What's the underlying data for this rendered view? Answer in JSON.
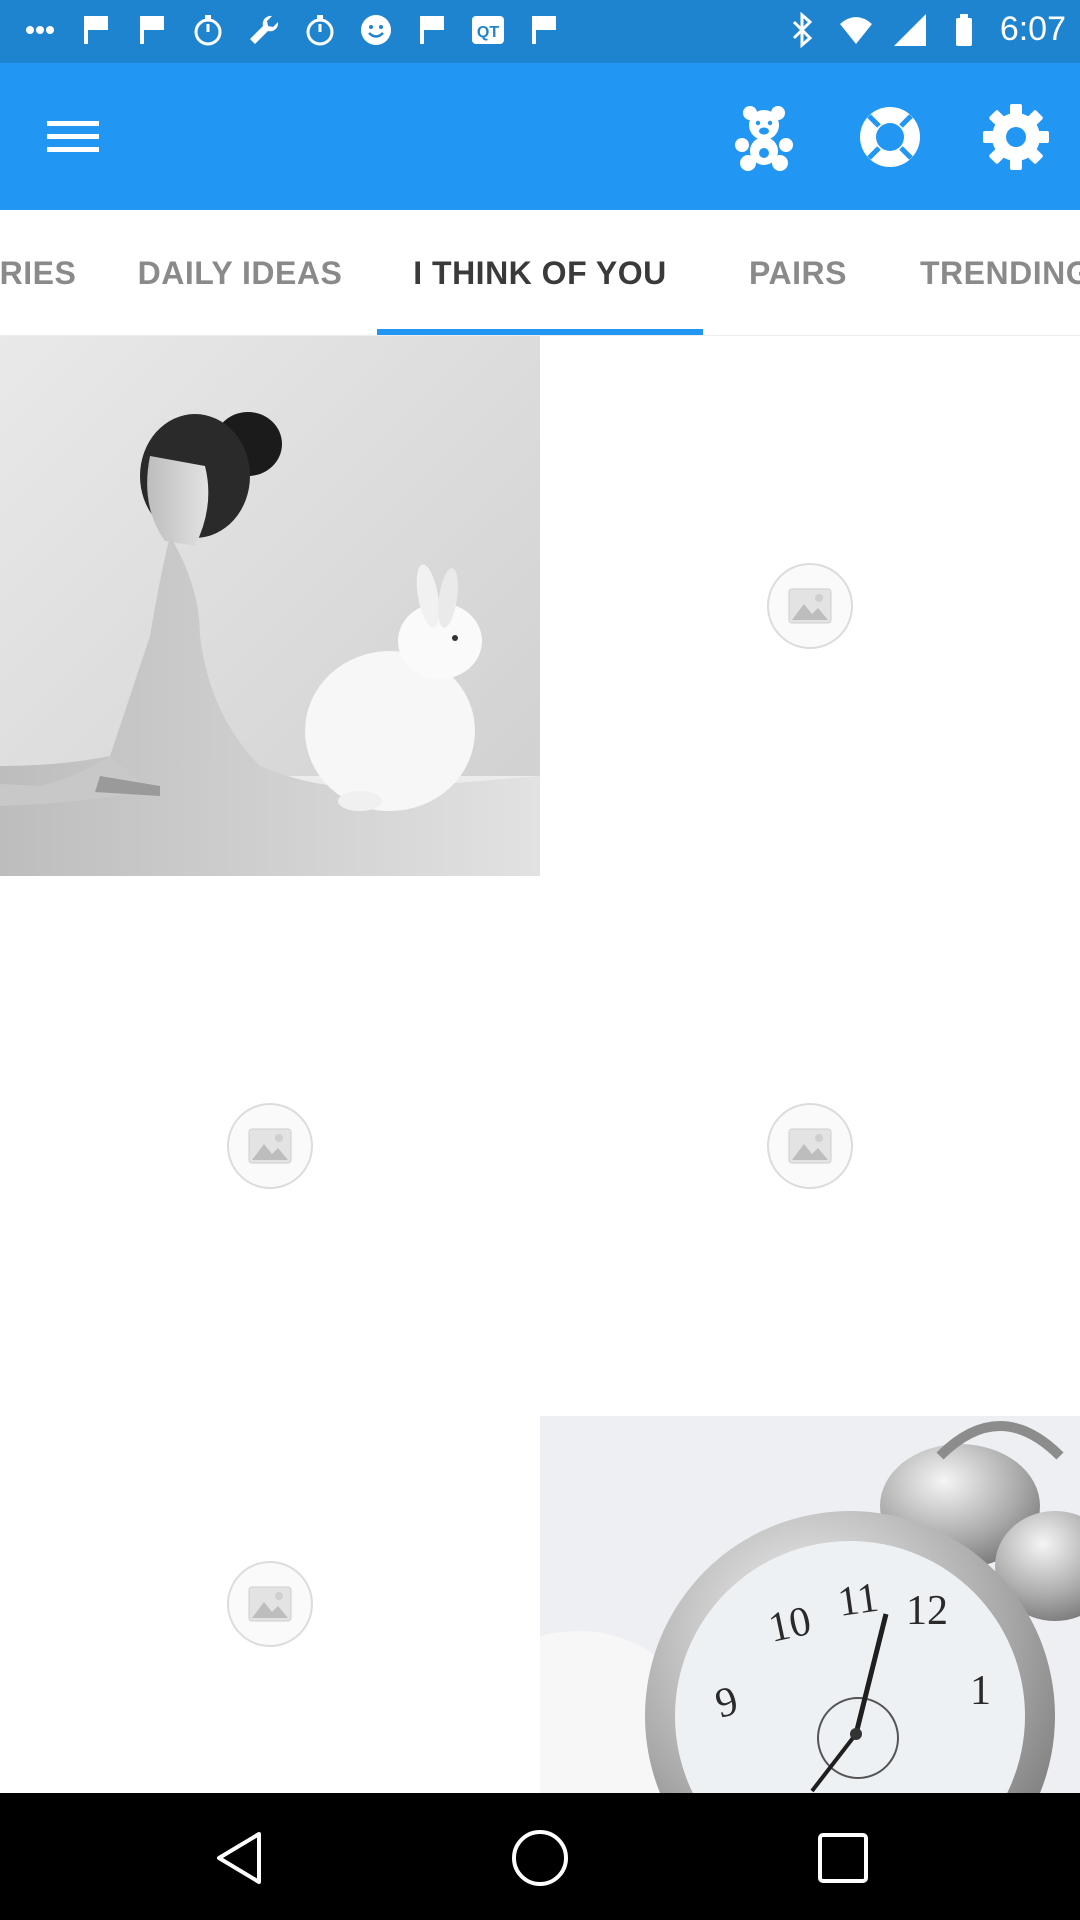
{
  "status_bar": {
    "time": "6:07",
    "left_icons": [
      "more-dots-icon",
      "flag-icon",
      "flag-icon",
      "timer-icon",
      "wrench-icon",
      "timer-icon",
      "smiley-icon",
      "flag-icon",
      "qt-icon",
      "flag-icon"
    ],
    "right_icons": [
      "bluetooth-icon",
      "wifi-icon",
      "signal-icon",
      "battery-icon"
    ],
    "background": "#1f84cf"
  },
  "app_bar": {
    "background": "#2196f3",
    "menu_icon": "menu-icon",
    "actions": [
      "teddy-bear-icon",
      "lifebuoy-icon",
      "settings-icon"
    ]
  },
  "tabs": {
    "items": [
      {
        "label": "RIES",
        "active": false
      },
      {
        "label": "DAILY IDEAS",
        "active": false
      },
      {
        "label": "I THINK OF YOU",
        "active": true
      },
      {
        "label": "PAIRS",
        "active": false
      },
      {
        "label": "TRENDING",
        "active": false
      }
    ],
    "indicator_color": "#2196f3"
  },
  "grid": {
    "items": [
      {
        "kind": "photo",
        "subject": "woman-with-rabbit"
      },
      {
        "kind": "placeholder",
        "icon": "image-placeholder-icon"
      },
      {
        "kind": "placeholder",
        "icon": "image-placeholder-icon"
      },
      {
        "kind": "placeholder",
        "icon": "image-placeholder-icon"
      },
      {
        "kind": "placeholder",
        "icon": "image-placeholder-icon"
      },
      {
        "kind": "photo",
        "subject": "alarm-clock"
      }
    ]
  },
  "nav_bar": {
    "buttons": [
      "back-icon",
      "home-icon",
      "recents-icon"
    ]
  }
}
